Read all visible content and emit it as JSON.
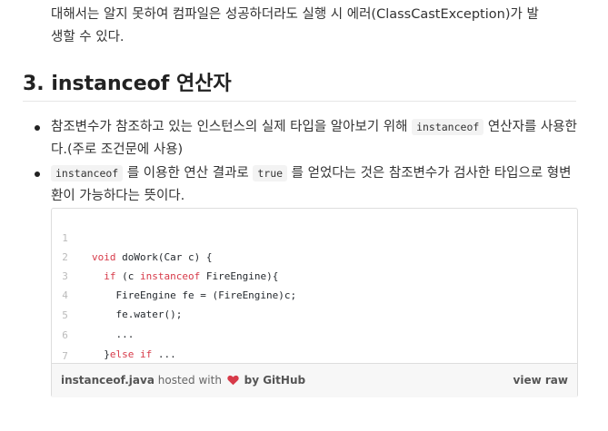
{
  "intro": {
    "line1": "대해서는 알지 못하여 컴파일은 성공하더라도 실행 시 에러(ClassCastException)가 발",
    "line2": "생할 수 있다."
  },
  "section": {
    "heading": "3. instanceof 연산자"
  },
  "bullets": [
    {
      "text_a": "참조변수가 참조하고 있는 인스턴스의 실제 타입을 알아보기 위해 ",
      "code_a": "instanceof",
      "text_b": " 연산자를 사용한다.(주로 조건문에 사용)"
    },
    {
      "code_a": "instanceof",
      "text_a": " 를 이용한 연산 결과로 ",
      "code_b": "true",
      "text_b": " 를 얻었다는 것은 참조변수가 검사한 타입으로 형변환이 가능하다는 뜻이다."
    }
  ],
  "gist": {
    "lines": [
      {
        "num": "1",
        "code": "void doWork(Car c) {"
      },
      {
        "num": "2",
        "code": "  if (c instanceof FireEngine){"
      },
      {
        "num": "3",
        "code": "    FireEngine fe = (FireEngine)c;"
      },
      {
        "num": "4",
        "code": "    fe.water();"
      },
      {
        "num": "5",
        "code": "    ..."
      },
      {
        "num": "6",
        "code": "  }else if ..."
      },
      {
        "num": "7",
        "code": "}"
      }
    ],
    "footer": {
      "filename": "instanceof.java",
      "hosted_with": "hosted with",
      "by_text": "by GitHub",
      "view_raw": "view raw",
      "heart_color": "#d73a49"
    }
  }
}
